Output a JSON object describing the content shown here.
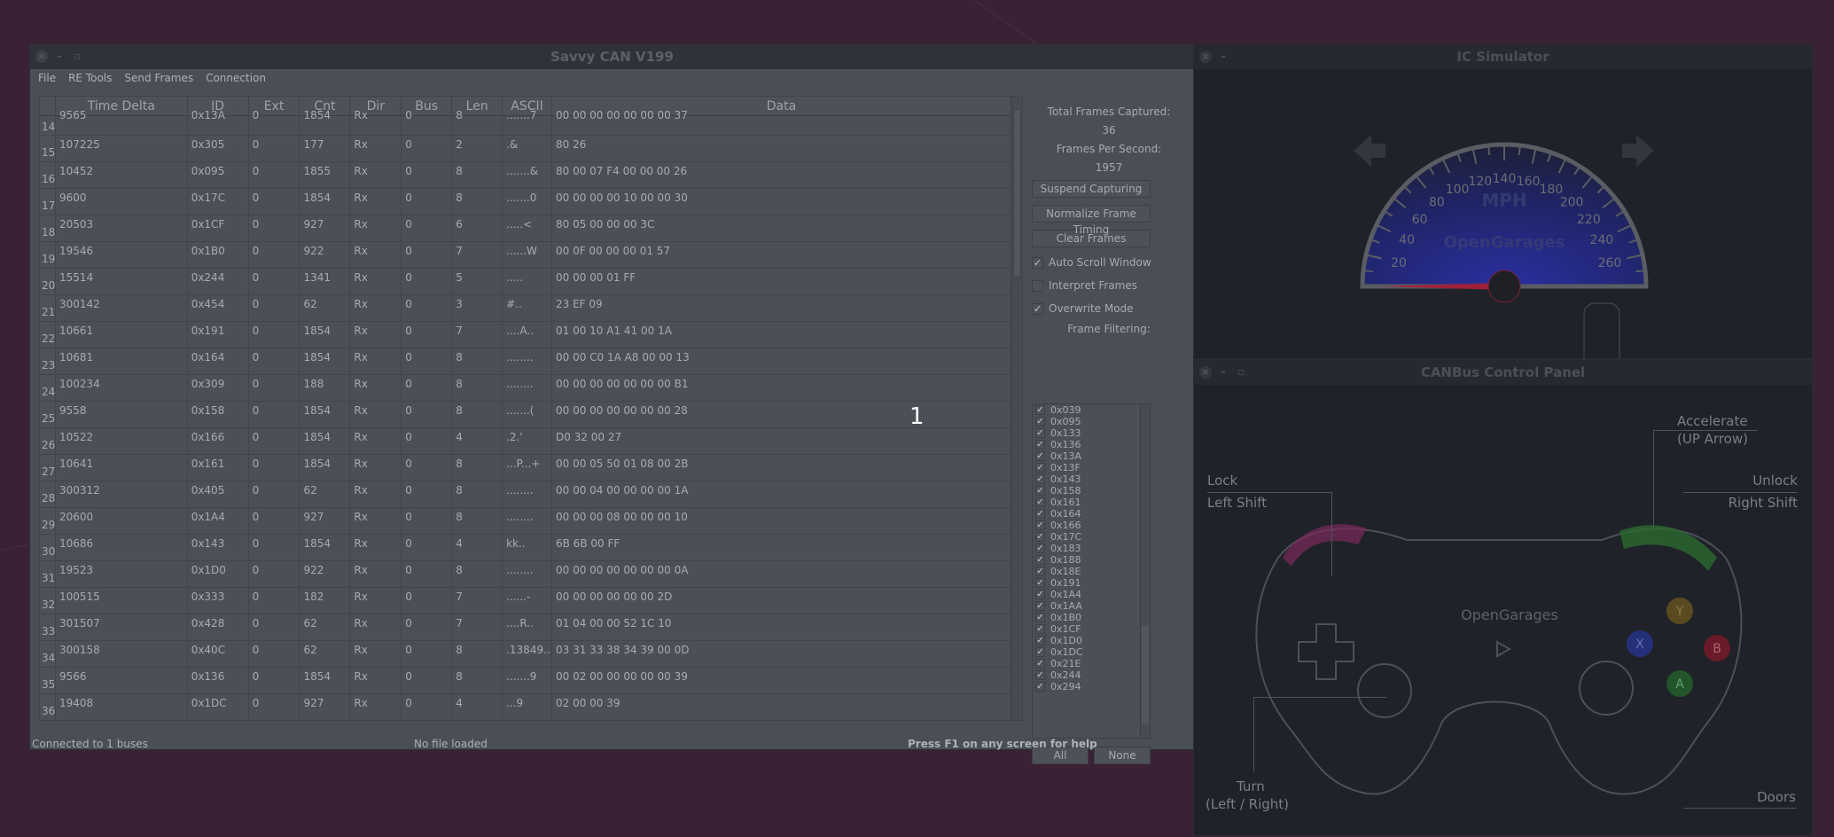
{
  "overlay_number": "1",
  "savvy": {
    "title": "Savvy CAN V199",
    "menu": [
      "File",
      "RE Tools",
      "Send Frames",
      "Connection"
    ],
    "columns": [
      "",
      "Time Delta",
      "ID",
      "Ext",
      "Cnt",
      "Dir",
      "Bus",
      "Len",
      "ASCII",
      "Data"
    ],
    "rows": [
      [
        "14",
        "9565",
        "0x13A",
        "0",
        "1854",
        "Rx",
        "0",
        "8",
        ".......7",
        "00 00 00 00 00 00 00 37"
      ],
      [
        "15",
        "107225",
        "0x305",
        "0",
        "177",
        "Rx",
        "0",
        "2",
        ".&",
        "80 26"
      ],
      [
        "16",
        "10452",
        "0x095",
        "0",
        "1855",
        "Rx",
        "0",
        "8",
        ".......&",
        "80 00 07 F4 00 00 00 26"
      ],
      [
        "17",
        "9600",
        "0x17C",
        "0",
        "1854",
        "Rx",
        "0",
        "8",
        ".......0",
        "00 00 00 00 10 00 00 30"
      ],
      [
        "18",
        "20503",
        "0x1CF",
        "0",
        "927",
        "Rx",
        "0",
        "6",
        ".....<",
        "80 05 00 00 00 3C"
      ],
      [
        "19",
        "19546",
        "0x1B0",
        "0",
        "922",
        "Rx",
        "0",
        "7",
        "......W",
        "00 0F 00 00 00 01 57"
      ],
      [
        "20",
        "15514",
        "0x244",
        "0",
        "1341",
        "Rx",
        "0",
        "5",
        ".....",
        "00 00 00 01 FF"
      ],
      [
        "21",
        "300142",
        "0x454",
        "0",
        "62",
        "Rx",
        "0",
        "3",
        "#..",
        "23 EF 09"
      ],
      [
        "22",
        "10661",
        "0x191",
        "0",
        "1854",
        "Rx",
        "0",
        "7",
        "....A..",
        "01 00 10 A1 41 00 1A"
      ],
      [
        "23",
        "10681",
        "0x164",
        "0",
        "1854",
        "Rx",
        "0",
        "8",
        "........",
        "00 00 C0 1A A8 00 00 13"
      ],
      [
        "24",
        "100234",
        "0x309",
        "0",
        "188",
        "Rx",
        "0",
        "8",
        "........",
        "00 00 00 00 00 00 00 B1"
      ],
      [
        "25",
        "9558",
        "0x158",
        "0",
        "1854",
        "Rx",
        "0",
        "8",
        ".......(",
        "00 00 00 00 00 00 00 28"
      ],
      [
        "26",
        "10522",
        "0x166",
        "0",
        "1854",
        "Rx",
        "0",
        "4",
        ".2.'",
        "D0 32 00 27"
      ],
      [
        "27",
        "10641",
        "0x161",
        "0",
        "1854",
        "Rx",
        "0",
        "8",
        "...P...+",
        "00 00 05 50 01 08 00 2B"
      ],
      [
        "28",
        "300312",
        "0x405",
        "0",
        "62",
        "Rx",
        "0",
        "8",
        "........",
        "00 00 04 00 00 00 00 1A"
      ],
      [
        "29",
        "20600",
        "0x1A4",
        "0",
        "927",
        "Rx",
        "0",
        "8",
        "........",
        "00 00 00 08 00 00 00 10"
      ],
      [
        "30",
        "10686",
        "0x143",
        "0",
        "1854",
        "Rx",
        "0",
        "4",
        "kk..",
        "6B 6B 00 FF"
      ],
      [
        "31",
        "19523",
        "0x1D0",
        "0",
        "922",
        "Rx",
        "0",
        "8",
        "........",
        "00 00 00 00 00 00 00 0A"
      ],
      [
        "32",
        "100515",
        "0x333",
        "0",
        "182",
        "Rx",
        "0",
        "7",
        "......-",
        "00 00 00 00 00 00 2D"
      ],
      [
        "33",
        "301507",
        "0x428",
        "0",
        "62",
        "Rx",
        "0",
        "7",
        "....R..",
        "01 04 00 00 52 1C 10"
      ],
      [
        "34",
        "300158",
        "0x40C",
        "0",
        "62",
        "Rx",
        "0",
        "8",
        ".13849..",
        "03 31 33 38 34 39 00 0D"
      ],
      [
        "35",
        "9566",
        "0x136",
        "0",
        "1854",
        "Rx",
        "0",
        "8",
        ".......9",
        "00 02 00 00 00 00 00 39"
      ],
      [
        "36",
        "19408",
        "0x1DC",
        "0",
        "927",
        "Rx",
        "0",
        "4",
        "...9",
        "02 00 00 39"
      ]
    ],
    "panel": {
      "total_label": "Total Frames Captured:",
      "total_value": "36",
      "fps_label": "Frames Per Second:",
      "fps_value": "1957",
      "suspend": "Suspend Capturing",
      "normalize": "Normalize Frame Timing",
      "clear": "Clear Frames",
      "auto_scroll": {
        "label": "Auto Scroll Window",
        "checked": true
      },
      "interpret": {
        "label": "Interpret Frames",
        "checked": false
      },
      "overwrite": {
        "label": "Overwrite Mode",
        "checked": true
      },
      "filter_label": "Frame Filtering:",
      "filters": [
        "0x039",
        "0x095",
        "0x133",
        "0x136",
        "0x13A",
        "0x13F",
        "0x143",
        "0x158",
        "0x161",
        "0x164",
        "0x166",
        "0x17C",
        "0x183",
        "0x188",
        "0x18E",
        "0x191",
        "0x1A4",
        "0x1AA",
        "0x1B0",
        "0x1CF",
        "0x1D0",
        "0x1DC",
        "0x21E",
        "0x244",
        "0x294"
      ],
      "all": "All",
      "none": "None"
    },
    "status": {
      "connection": "Connected to 1 buses",
      "file": "No file loaded",
      "help": "Press F1 on any screen for help"
    }
  },
  "ic": {
    "title": "IC Simulator",
    "unit": "MPH",
    "brand": "OpenGarages",
    "ticks": [
      "20",
      "40",
      "60",
      "80",
      "100",
      "120",
      "140",
      "160",
      "180",
      "200",
      "220",
      "240",
      "260"
    ],
    "speed": 0,
    "needle_color": "#a0203a",
    "dial_color": "#2a2f9a"
  },
  "cp": {
    "title": "CANBus Control Panel",
    "accelerate": "Accelerate",
    "accelerate_key": "(UP Arrow)",
    "lock": "Lock",
    "lock_key": "Left Shift",
    "unlock": "Unlock",
    "unlock_key": "Right Shift",
    "turn": "Turn",
    "turn_key": "(Left / Right)",
    "doors": "Doors",
    "brand": "OpenGarages",
    "buttons": [
      "Y",
      "X",
      "B",
      "A"
    ]
  }
}
